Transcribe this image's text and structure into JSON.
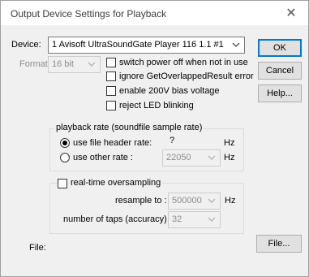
{
  "window": {
    "title": "Output Device Settings for Playback",
    "close_glyph": "✕"
  },
  "device": {
    "label": "Device:",
    "value": "1 Avisoft UltraSoundGate Player 116 1.1 #1"
  },
  "format": {
    "label": "Format:",
    "value": "16 bit"
  },
  "options": {
    "switch_power": "switch power off when not in use",
    "ignore_overlapped": "ignore GetOverlappedResult error",
    "enable_bias": "enable 200V bias voltage",
    "reject_led": "reject LED blinking"
  },
  "buttons": {
    "ok": "OK",
    "cancel": "Cancel",
    "help": "Help...",
    "file": "File..."
  },
  "playback_rate": {
    "group_label": "playback rate (soundfile sample rate)",
    "file_header_label": "use file header rate:",
    "file_header_value": "?",
    "file_header_unit": "Hz",
    "other_rate_label": "use other rate :",
    "other_rate_value": "22050",
    "other_rate_unit": "Hz",
    "selected": "file_header"
  },
  "oversampling": {
    "checkbox_label": "real-time oversampling",
    "resample_label": "resample to :",
    "resample_value": "500000",
    "resample_unit": "Hz",
    "taps_label": "number of taps (accuracy) :",
    "taps_value": "32"
  },
  "file": {
    "label": "File:"
  },
  "colors": {
    "accent": "#0078d7",
    "disabled_text": "#8c8c8c",
    "client_bg": "#f0f0f0"
  }
}
